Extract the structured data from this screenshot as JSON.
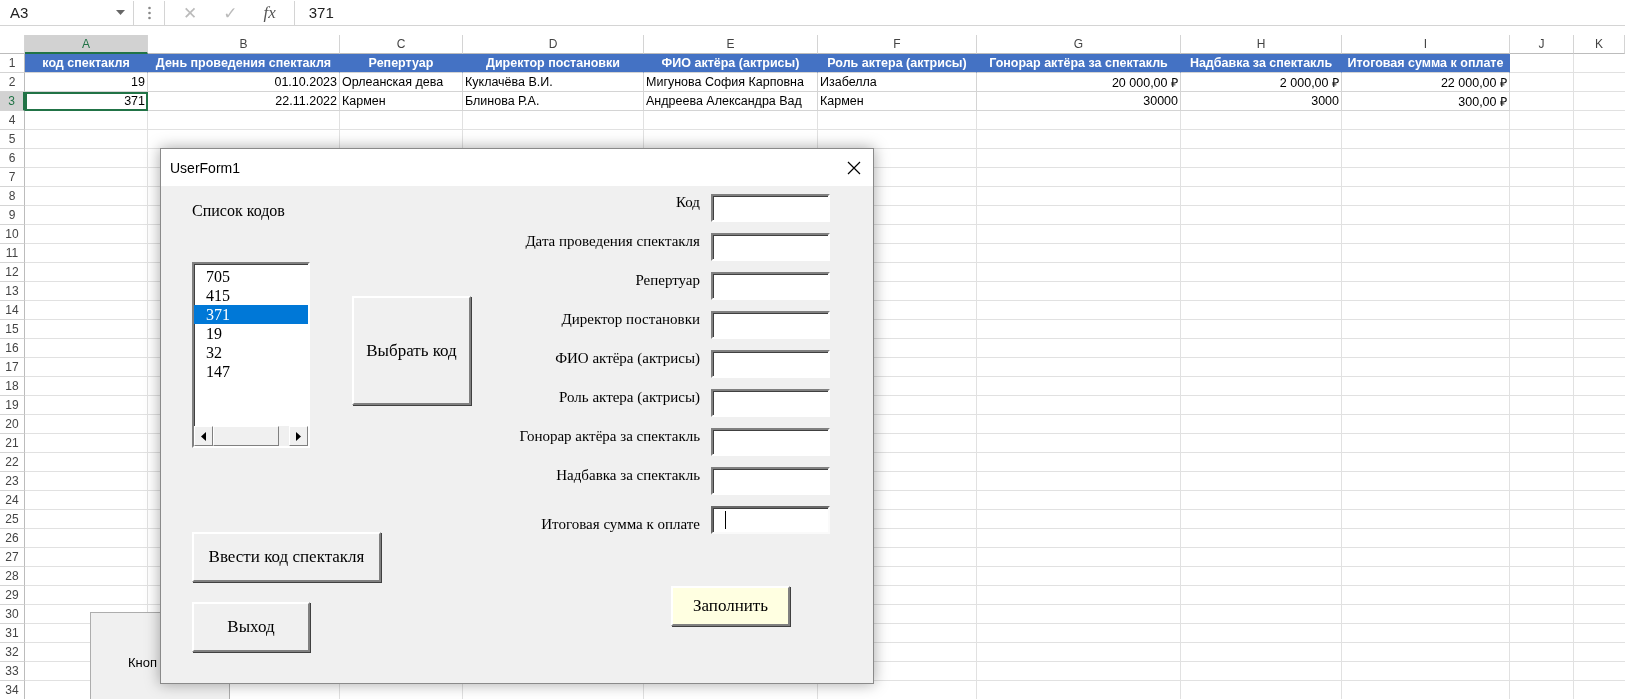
{
  "formula_bar": {
    "name_box": "A3",
    "cancel": "✕",
    "enter": "✓",
    "function": "fx",
    "value": "371"
  },
  "columns": [
    {
      "label": "A",
      "selected": true,
      "kind": "number"
    },
    {
      "label": "B",
      "selected": false,
      "kind": "number"
    },
    {
      "label": "C",
      "selected": false,
      "kind": "text"
    },
    {
      "label": "D",
      "selected": false,
      "kind": "text"
    },
    {
      "label": "E",
      "selected": false,
      "kind": "text"
    },
    {
      "label": "F",
      "selected": false,
      "kind": "text"
    },
    {
      "label": "G",
      "selected": false,
      "kind": "number"
    },
    {
      "label": "H",
      "selected": false,
      "kind": "number"
    },
    {
      "label": "I",
      "selected": false,
      "kind": "number"
    },
    {
      "label": "J",
      "selected": false
    },
    {
      "label": "K",
      "selected": false
    }
  ],
  "rows": [
    {
      "label": "1",
      "selected": false,
      "kind": "header",
      "cells": [
        {
          "text": "код спектакля",
          "selected": false
        },
        {
          "text": "День проведения спектакля",
          "selected": false
        },
        {
          "text": "Репертуар",
          "selected": false
        },
        {
          "text": "Директор постановки",
          "selected": false
        },
        {
          "text": "ФИО актёра (актрисы)",
          "selected": false
        },
        {
          "text": "Роль актера (актрисы)",
          "selected": false
        },
        {
          "text": "Гонорар актёра за спектакль",
          "selected": false
        },
        {
          "text": "Надбавка за спектакль",
          "selected": false
        },
        {
          "text": "Итоговая сумма к оплате",
          "selected": false
        }
      ]
    },
    {
      "label": "2",
      "selected": false,
      "kind": "data",
      "cells": [
        {
          "text": "19",
          "selected": false
        },
        {
          "text": "01.10.2023",
          "selected": false
        },
        {
          "text": "Орлеанская дева",
          "selected": false
        },
        {
          "text": "Куклачёва В.И.",
          "selected": false
        },
        {
          "text": "Мигунова София Карповна",
          "selected": false
        },
        {
          "text": "Изабелла",
          "selected": false
        },
        {
          "text": "20 000,00 ₽",
          "selected": false
        },
        {
          "text": "2 000,00 ₽",
          "selected": false
        },
        {
          "text": "22 000,00 ₽",
          "selected": false
        }
      ]
    },
    {
      "label": "3",
      "selected": true,
      "kind": "data",
      "cells": [
        {
          "text": "371",
          "selected": true
        },
        {
          "text": "22.11.2022",
          "selected": false
        },
        {
          "text": "Кармен",
          "selected": false
        },
        {
          "text": "Блинова Р.А.",
          "selected": false
        },
        {
          "text": "Андреева Александра Вад",
          "selected": false
        },
        {
          "text": "Кармен",
          "selected": false
        },
        {
          "text": "30000",
          "selected": false
        },
        {
          "text": "3000",
          "selected": false
        },
        {
          "text": "300,00 ₽",
          "selected": false
        }
      ]
    },
    {
      "label": "4",
      "selected": false
    },
    {
      "label": "5",
      "selected": false
    },
    {
      "label": "6",
      "selected": false
    },
    {
      "label": "7",
      "selected": false
    },
    {
      "label": "8",
      "selected": false
    },
    {
      "label": "9",
      "selected": false
    },
    {
      "label": "10",
      "selected": false
    },
    {
      "label": "11",
      "selected": false
    },
    {
      "label": "12",
      "selected": false
    },
    {
      "label": "13",
      "selected": false
    },
    {
      "label": "14",
      "selected": false
    },
    {
      "label": "15",
      "selected": false
    },
    {
      "label": "16",
      "selected": false
    },
    {
      "label": "17",
      "selected": false
    },
    {
      "label": "18",
      "selected": false
    },
    {
      "label": "19",
      "selected": false
    },
    {
      "label": "20",
      "selected": false
    },
    {
      "label": "21",
      "selected": false
    },
    {
      "label": "22",
      "selected": false
    },
    {
      "label": "23",
      "selected": false
    },
    {
      "label": "24",
      "selected": false
    },
    {
      "label": "25",
      "selected": false
    },
    {
      "label": "26",
      "selected": false
    },
    {
      "label": "27",
      "selected": false
    },
    {
      "label": "28",
      "selected": false
    },
    {
      "label": "29",
      "selected": false
    },
    {
      "label": "30",
      "selected": false
    },
    {
      "label": "31",
      "selected": false
    },
    {
      "label": "32",
      "selected": false
    },
    {
      "label": "33",
      "selected": false
    },
    {
      "label": "34",
      "selected": false
    }
  ],
  "sheet_button": {
    "label": "Кноп"
  },
  "dialog": {
    "title": "UserForm1",
    "list_label": "Список кодов",
    "list_items": [
      {
        "text": "705",
        "selected": false
      },
      {
        "text": "415",
        "selected": false
      },
      {
        "text": "371",
        "selected": true
      },
      {
        "text": "19",
        "selected": false
      },
      {
        "text": "32",
        "selected": false
      },
      {
        "text": "147",
        "selected": false
      }
    ],
    "select_button": "Выбрать код",
    "enter_button": "Ввести код спектакля",
    "exit_button": "Выход",
    "fields": [
      {
        "label": "Код",
        "focused": false
      },
      {
        "label": "Дата проведения спектакля",
        "focused": false
      },
      {
        "label": "Репертуар",
        "focused": false
      },
      {
        "label": "Директор постановки",
        "focused": false
      },
      {
        "label": "ФИО актёра (актрисы)",
        "focused": false
      },
      {
        "label": "Роль актера (актрисы)",
        "focused": false
      },
      {
        "label": "Гонорар актёра за спектакль",
        "focused": false
      },
      {
        "label": "Надбавка за спектакль",
        "focused": false
      },
      {
        "label": "Итоговая сумма к оплате",
        "focused": true
      }
    ],
    "fill_button": "Заполнить"
  }
}
